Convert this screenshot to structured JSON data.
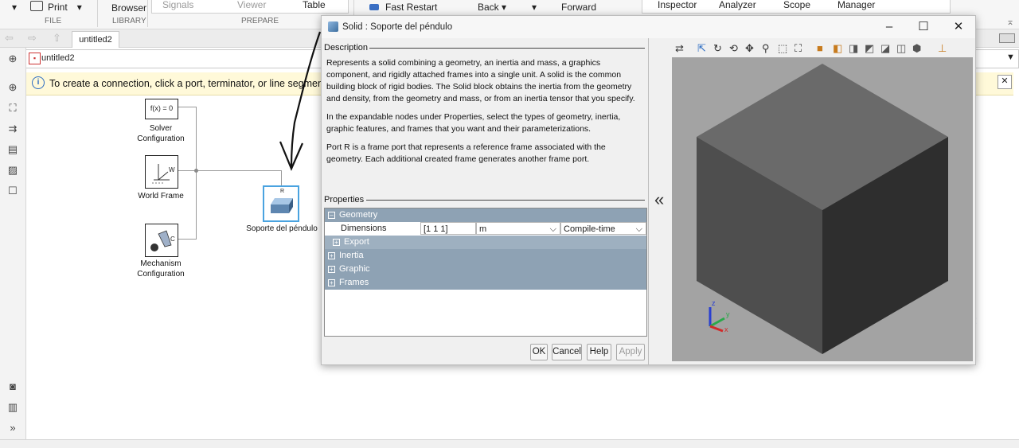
{
  "toolstrip": {
    "print_label": "Print",
    "file_label": "FILE",
    "browser_label": "Browser",
    "library_label": "LIBRARY",
    "signals_label": "Signals",
    "viewer_label": "Viewer",
    "table_label": "Table",
    "prepare_label": "PREPARE",
    "fast_restart_label": "Fast Restart",
    "back_label": "Back",
    "forward_label": "Forward",
    "inspector_label": "Inspector",
    "analyzer_label": "Analyzer",
    "scope_label": "Scope",
    "manager_label": "Manager"
  },
  "nav": {
    "tab_label": "untitled2",
    "address": "untitled2"
  },
  "info_bar": {
    "message": "To create a connection, click a port, terminator, or line segmen"
  },
  "canvas": {
    "solver_text": "f(x) = 0",
    "solver_label_1": "Solver",
    "solver_label_2": "Configuration",
    "world_label": "World Frame",
    "world_port": "W",
    "mechanism_label_1": "Mechanism",
    "mechanism_label_2": "Configuration",
    "mechanism_port": "C",
    "solid_label": "Soporte del péndulo",
    "solid_port": "R"
  },
  "dialog": {
    "title": "Solid : Soporte del péndulo",
    "description_header": "Description",
    "description_p1": "Represents a solid combining a geometry, an inertia and mass, a graphics component, and rigidly attached frames into a single unit. A solid is the common building block of rigid bodies. The Solid block obtains the inertia from the geometry and density, from the geometry and mass, or from an inertia tensor that you specify.",
    "description_p2": "In the expandable nodes under Properties, select the types of geometry, inertia, graphic features, and frames that you want and their parameterizations.",
    "description_p3": "Port R is a frame port that represents a reference frame associated with the geometry. Each additional created frame generates another frame port.",
    "properties_header": "Properties",
    "geometry_label": "Geometry",
    "dimensions_label": "Dimensions",
    "dimensions_value": "[1 1 1]",
    "dimensions_unit": "m",
    "dimensions_mode": "Compile-time",
    "export_label": "Export",
    "inertia_label": "Inertia",
    "graphic_label": "Graphic",
    "frames_label": "Frames",
    "ok_label": "OK",
    "cancel_label": "Cancel",
    "help_label": "Help",
    "apply_label": "Apply"
  },
  "viewer": {
    "axis_x": "x",
    "axis_y": "y",
    "axis_z": "z",
    "cube_top_color": "#6a6a6a",
    "cube_left_color": "#4e4e4e",
    "cube_right_color": "#2e2e2e"
  }
}
